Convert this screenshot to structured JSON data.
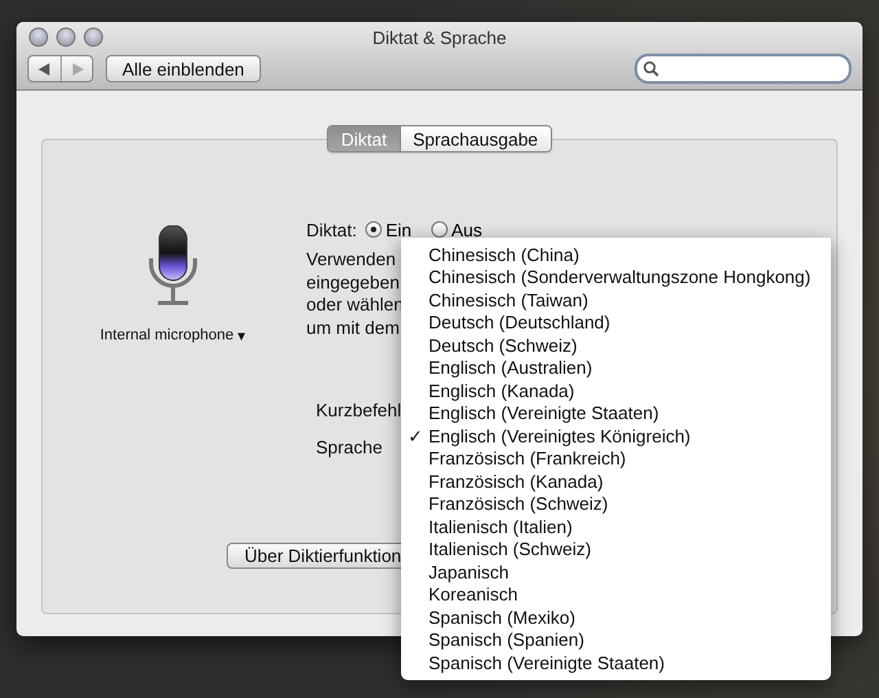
{
  "window": {
    "title": "Diktat & Sprache"
  },
  "toolbar": {
    "show_all_button": "Alle einblenden"
  },
  "tabs": [
    {
      "label": "Diktat",
      "selected": true
    },
    {
      "label": "Sprachausgabe",
      "selected": false
    }
  ],
  "microphone": {
    "label": "Internal microphone",
    "caret": "▾"
  },
  "dictation": {
    "label": "Diktat:",
    "options": [
      {
        "label": "Ein",
        "selected": true
      },
      {
        "label": "Aus",
        "selected": false
      }
    ]
  },
  "description_lines": [
    "Verwenden",
    "eingegeben",
    "oder wählen",
    "um mit dem"
  ],
  "shortcut_label": "Kurzbefehl",
  "language_label": "Sprache",
  "about_button": "Über Diktierfunktion",
  "language_menu": {
    "check_mark": "✓",
    "items": [
      {
        "label": "Chinesisch (China)",
        "selected": false
      },
      {
        "label": "Chinesisch (Sonderverwaltungszone Hongkong)",
        "selected": false
      },
      {
        "label": "Chinesisch (Taiwan)",
        "selected": false
      },
      {
        "label": "Deutsch (Deutschland)",
        "selected": false
      },
      {
        "label": "Deutsch (Schweiz)",
        "selected": false
      },
      {
        "label": "Englisch (Australien)",
        "selected": false
      },
      {
        "label": "Englisch (Kanada)",
        "selected": false
      },
      {
        "label": "Englisch (Vereinigte Staaten)",
        "selected": false
      },
      {
        "label": "Englisch (Vereinigtes Königreich)",
        "selected": true
      },
      {
        "label": "Französisch (Frankreich)",
        "selected": false
      },
      {
        "label": "Französisch (Kanada)",
        "selected": false
      },
      {
        "label": "Französisch (Schweiz)",
        "selected": false
      },
      {
        "label": "Italienisch (Italien)",
        "selected": false
      },
      {
        "label": "Italienisch (Schweiz)",
        "selected": false
      },
      {
        "label": "Japanisch",
        "selected": false
      },
      {
        "label": "Koreanisch",
        "selected": false
      },
      {
        "label": "Spanisch (Mexiko)",
        "selected": false
      },
      {
        "label": "Spanisch (Spanien)",
        "selected": false
      },
      {
        "label": "Spanisch (Vereinigte Staaten)",
        "selected": false
      }
    ]
  }
}
